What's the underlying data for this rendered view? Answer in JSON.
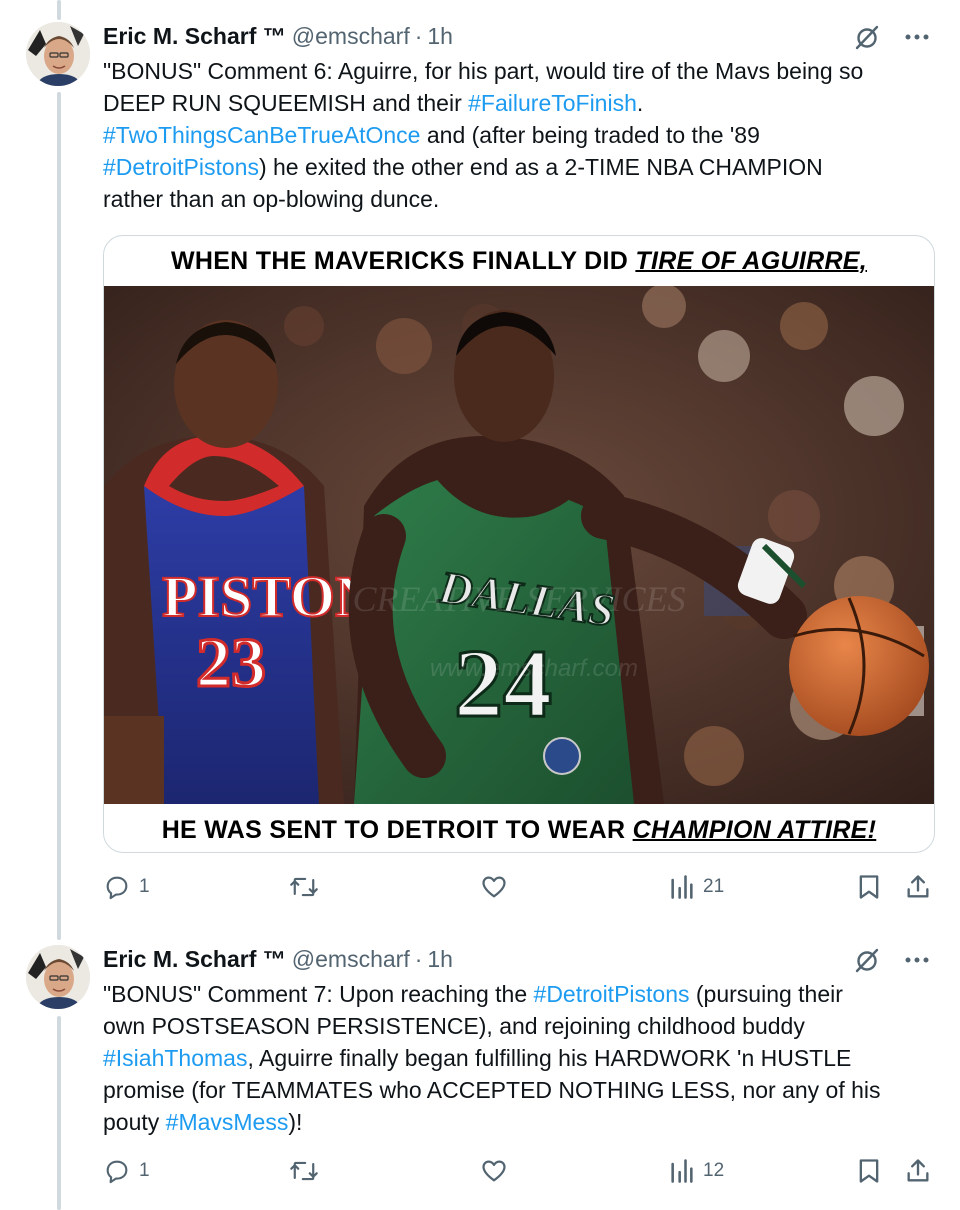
{
  "tweets": [
    {
      "author_name": "Eric M. Scharf ™",
      "handle": "@emscharf",
      "separator": "·",
      "time": "1h",
      "lines": [
        [
          {
            "t": "\"BONUS\" Comment 6: Aguirre, for his part, would tire of the Mavs being so"
          }
        ],
        [
          {
            "t": "DEEP RUN SQUEEMISH and their "
          },
          {
            "t": "#FailureToFinish",
            "tag": true
          },
          {
            "t": "."
          }
        ],
        [
          {
            "t": "#TwoThingsCanBeTrueAtOnce",
            "tag": true
          },
          {
            "t": " and (after being traded to the '89"
          }
        ],
        [
          {
            "t": "#DetroitPistons",
            "tag": true
          },
          {
            "t": ") he exited the other end as a 2-TIME NBA CHAMPION"
          }
        ],
        [
          {
            "t": "rather than an op-blowing dunce."
          }
        ]
      ],
      "media": {
        "caption_top_plain": "WHEN THE MAVERICKS FINALLY DID ",
        "caption_top_emph": "TIRE OF AGUIRRE,",
        "caption_bottom_plain": "HE WAS SENT TO DETROIT TO WEAR ",
        "caption_bottom_emph": "CHAMPION ATTIRE!",
        "jersey_left_text": "PISTONS",
        "jersey_left_number": "23",
        "jersey_right_text": "DALLAS",
        "jersey_right_number": "24",
        "watermark": "CREATIVE SERVICES",
        "watermark_url": "www.emscharf.com"
      },
      "stats": {
        "replies": "1",
        "retweets": "",
        "likes": "",
        "views": "21"
      }
    },
    {
      "author_name": "Eric M. Scharf ™",
      "handle": "@emscharf",
      "separator": "·",
      "time": "1h",
      "lines": [
        [
          {
            "t": "\"BONUS\" Comment 7: Upon reaching the "
          },
          {
            "t": "#DetroitPistons",
            "tag": true
          },
          {
            "t": " (pursuing their"
          }
        ],
        [
          {
            "t": "own POSTSEASON PERSISTENCE), and rejoining childhood buddy"
          }
        ],
        [
          {
            "t": "#IsiahThomas",
            "tag": true
          },
          {
            "t": ", Aguirre finally began fulfilling his HARDWORK 'n HUSTLE"
          }
        ],
        [
          {
            "t": "promise (for TEAMMATES who ACCEPTED NOTHING LESS, nor any of his"
          }
        ],
        [
          {
            "t": "pouty "
          },
          {
            "t": "#MavsMess",
            "tag": true
          },
          {
            "t": ")!"
          }
        ]
      ],
      "stats": {
        "replies": "1",
        "retweets": "",
        "likes": "",
        "views": "12"
      }
    }
  ],
  "colors": {
    "text": "#0f1419",
    "muted": "#536471",
    "link": "#1d9bf0",
    "border": "#cfd9de"
  },
  "icons": [
    "grok-icon",
    "more-icon",
    "reply-icon",
    "retweet-icon",
    "like-icon",
    "views-icon",
    "bookmark-icon",
    "share-icon"
  ]
}
